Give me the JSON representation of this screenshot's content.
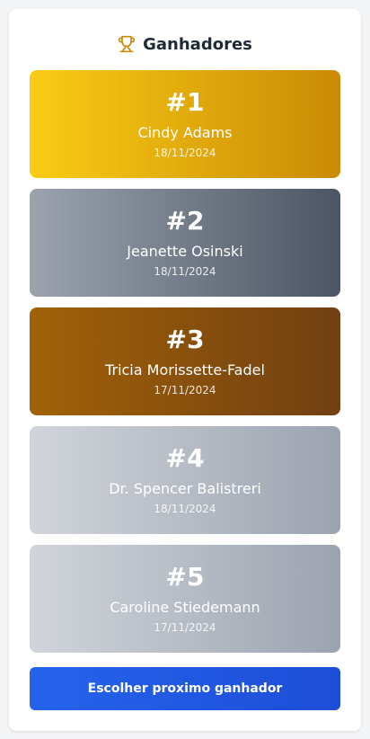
{
  "header": {
    "title": "Ganhadores",
    "icon": "trophy-icon",
    "icon_color": "#ca8a04"
  },
  "winners": [
    {
      "rank": "#1",
      "name": "Cindy Adams",
      "date": "18/11/2024",
      "colors": [
        "#facc15",
        "#ca8a04"
      ]
    },
    {
      "rank": "#2",
      "name": "Jeanette Osinski",
      "date": "18/11/2024",
      "colors": [
        "#9ca3af",
        "#4b5563"
      ]
    },
    {
      "rank": "#3",
      "name": "Tricia Morissette-Fadel",
      "date": "17/11/2024",
      "colors": [
        "#a16207",
        "#713f12"
      ]
    },
    {
      "rank": "#4",
      "name": "Dr. Spencer Balistreri",
      "date": "18/11/2024",
      "colors": [
        "#d1d5db",
        "#9ca3af"
      ]
    },
    {
      "rank": "#5",
      "name": "Caroline Stiedemann",
      "date": "17/11/2024",
      "colors": [
        "#d1d5db",
        "#9ca3af"
      ]
    }
  ],
  "action": {
    "label": "Escolher proximo ganhador",
    "color": "#2563eb"
  }
}
